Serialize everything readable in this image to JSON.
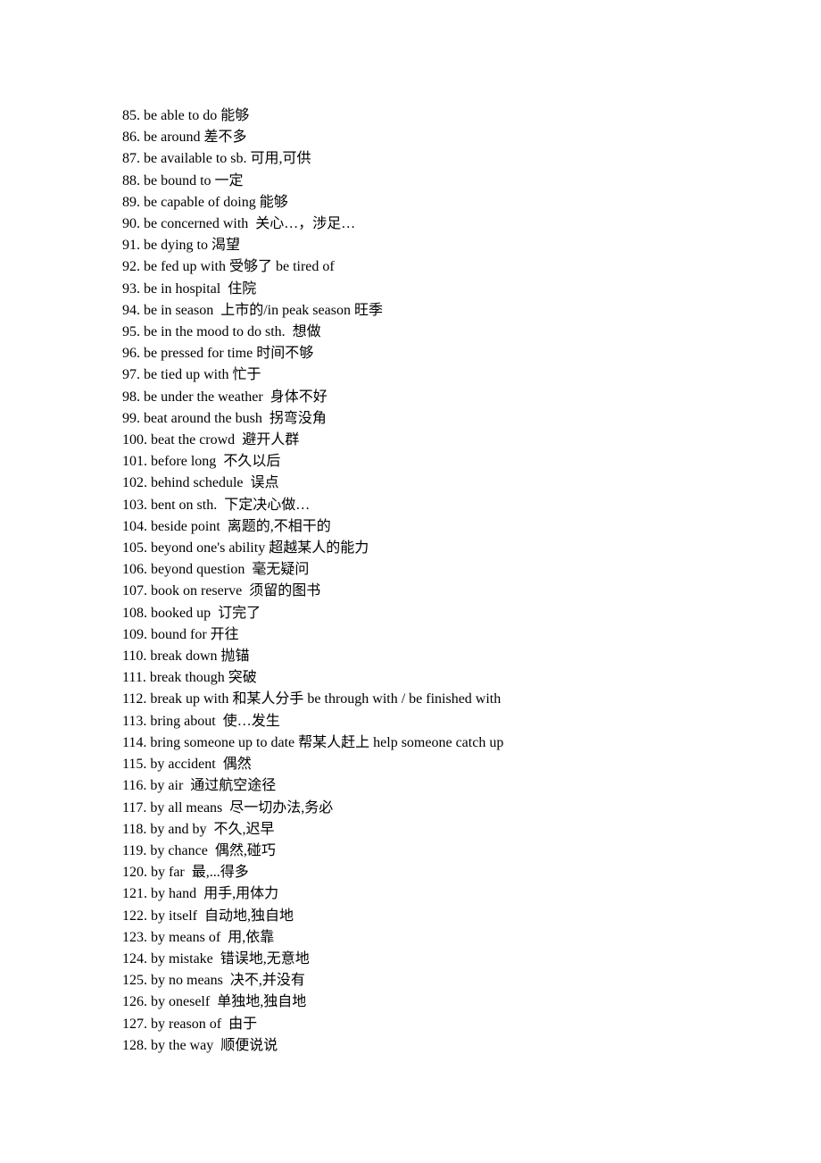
{
  "entries": [
    {
      "num": "85",
      "phrase": "be able to do",
      "definition": "能够"
    },
    {
      "num": "86",
      "phrase": "be around",
      "definition": "差不多"
    },
    {
      "num": "87",
      "phrase": "be available to sb.",
      "definition": "可用,可供"
    },
    {
      "num": "88",
      "phrase": "be bound to",
      "definition": "一定"
    },
    {
      "num": "89",
      "phrase": "be capable of doing",
      "definition": "能够"
    },
    {
      "num": "90",
      "phrase": "be concerned with ",
      "definition": "关心…，涉足…"
    },
    {
      "num": "91",
      "phrase": "be dying to",
      "definition": "渴望"
    },
    {
      "num": "92",
      "phrase": "be fed up with",
      "definition": "受够了 be tired of"
    },
    {
      "num": "93",
      "phrase": "be in hospital ",
      "definition": "住院"
    },
    {
      "num": "94",
      "phrase": "be in season ",
      "definition": "上市的/in peak season 旺季"
    },
    {
      "num": "95",
      "phrase": "be in the mood to do sth. ",
      "definition": "想做"
    },
    {
      "num": "96",
      "phrase": "be pressed for time",
      "definition": "时间不够"
    },
    {
      "num": "97",
      "phrase": "be tied up with",
      "definition": "忙于"
    },
    {
      "num": "98",
      "phrase": "be under the weather ",
      "definition": "身体不好"
    },
    {
      "num": "99",
      "phrase": "beat around the bush ",
      "definition": "拐弯没角"
    },
    {
      "num": "100",
      "phrase": "beat the crowd ",
      "definition": "避开人群"
    },
    {
      "num": "101",
      "phrase": "before long ",
      "definition": "不久以后"
    },
    {
      "num": "102",
      "phrase": "behind schedule ",
      "definition": "误点"
    },
    {
      "num": "103",
      "phrase": "bent on sth. ",
      "definition": "下定决心做…"
    },
    {
      "num": "104",
      "phrase": "beside point ",
      "definition": "离题的,不相干的"
    },
    {
      "num": "105",
      "phrase": "beyond one's ability",
      "definition": "超越某人的能力"
    },
    {
      "num": "106",
      "phrase": "beyond question ",
      "definition": "毫无疑问"
    },
    {
      "num": "107",
      "phrase": "book on reserve ",
      "definition": "须留的图书"
    },
    {
      "num": "108",
      "phrase": "booked up ",
      "definition": "订完了"
    },
    {
      "num": "109",
      "phrase": "bound for",
      "definition": "开往"
    },
    {
      "num": "110",
      "phrase": "break down",
      "definition": "抛锚"
    },
    {
      "num": "111",
      "phrase": "break though",
      "definition": "突破"
    },
    {
      "num": "112",
      "phrase": "break up with",
      "definition": "和某人分手 be through with / be finished with"
    },
    {
      "num": "113",
      "phrase": "bring about ",
      "definition": "使…发生"
    },
    {
      "num": "114",
      "phrase": "bring someone up to date",
      "definition": "帮某人赶上 help someone catch up"
    },
    {
      "num": "115",
      "phrase": "by accident ",
      "definition": "偶然"
    },
    {
      "num": "116",
      "phrase": "by air ",
      "definition": "通过航空途径"
    },
    {
      "num": "117",
      "phrase": "by all means ",
      "definition": "尽一切办法,务必"
    },
    {
      "num": "118",
      "phrase": "by and by ",
      "definition": "不久,迟早"
    },
    {
      "num": "119",
      "phrase": "by chance ",
      "definition": "偶然,碰巧"
    },
    {
      "num": "120",
      "phrase": "by far ",
      "definition": "最,...得多"
    },
    {
      "num": "121",
      "phrase": "by hand ",
      "definition": "用手,用体力"
    },
    {
      "num": "122",
      "phrase": "by itself ",
      "definition": "自动地,独自地"
    },
    {
      "num": "123",
      "phrase": "by means of ",
      "definition": "用,依靠"
    },
    {
      "num": "124",
      "phrase": "by mistake ",
      "definition": "错误地,无意地"
    },
    {
      "num": "125",
      "phrase": "by no means ",
      "definition": "决不,并没有"
    },
    {
      "num": "126",
      "phrase": "by oneself ",
      "definition": "单独地,独自地"
    },
    {
      "num": "127",
      "phrase": "by reason of ",
      "definition": "由于"
    },
    {
      "num": "128",
      "phrase": "by the way ",
      "definition": "顺便说说"
    }
  ]
}
